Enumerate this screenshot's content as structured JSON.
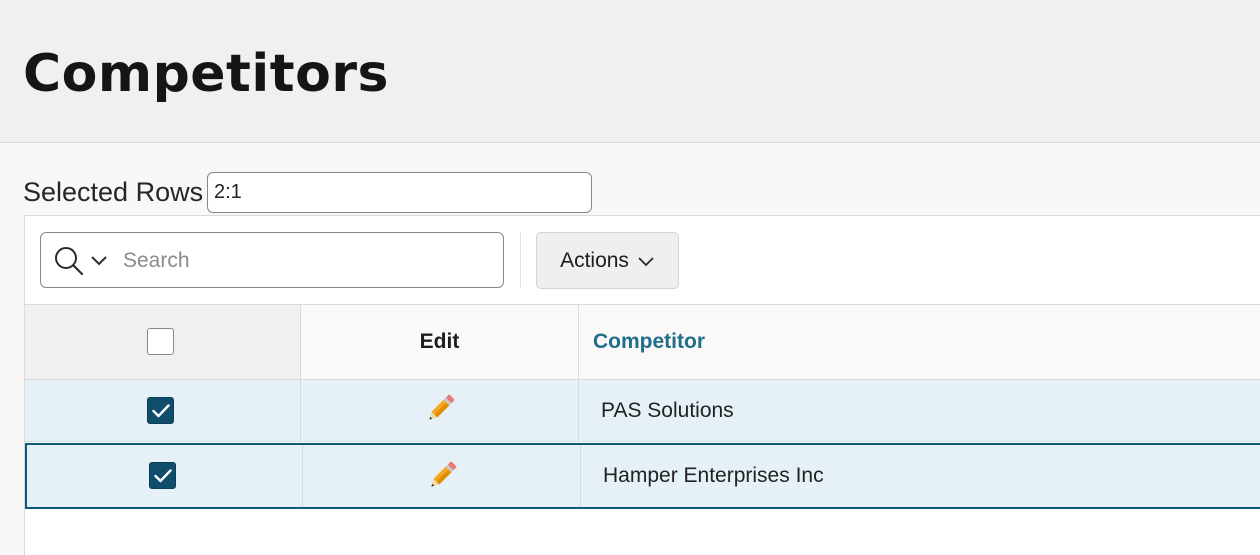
{
  "page": {
    "title": "Competitors"
  },
  "selected_rows": {
    "label": "Selected Rows",
    "value": "2:1"
  },
  "toolbar": {
    "search_placeholder": "Search",
    "actions_label": "Actions"
  },
  "grid": {
    "columns": {
      "edit": "Edit",
      "competitor": "Competitor"
    },
    "rows": [
      {
        "checked": true,
        "competitor": "PAS Solutions"
      },
      {
        "checked": true,
        "competitor": "Hamper Enterprises Inc"
      }
    ]
  },
  "colors": {
    "accent": "#0f4d6b",
    "header_link": "#1f6f8b",
    "row_selected": "#e5f1f7"
  },
  "icons": [
    "search-icon",
    "chevron-down-icon",
    "pencil-icon",
    "checkmark-icon"
  ]
}
